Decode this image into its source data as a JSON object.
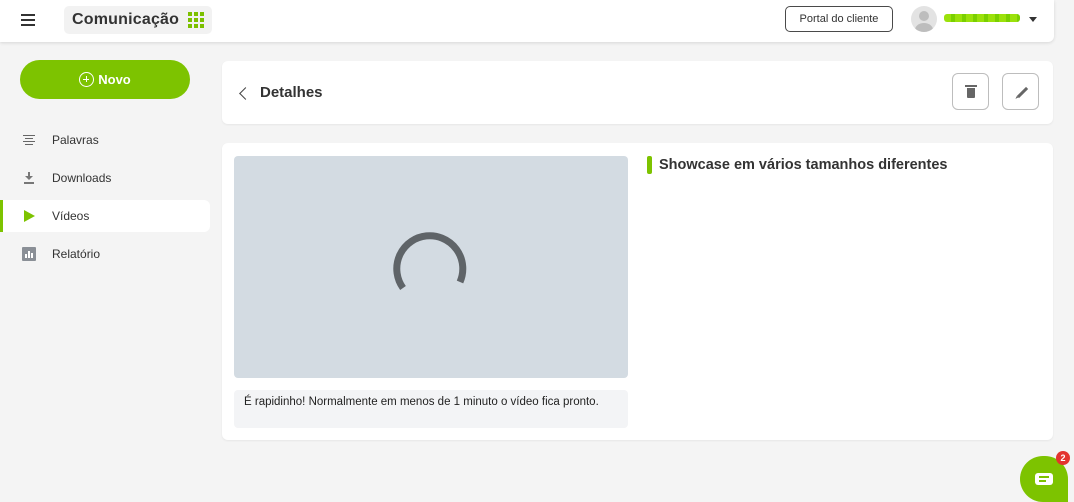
{
  "header": {
    "app_title": "Comunicação",
    "portal_label": "Portal do cliente"
  },
  "sidebar": {
    "new_label": "Novo",
    "items": [
      {
        "label": "Palavras",
        "icon": "lines-icon"
      },
      {
        "label": "Downloads",
        "icon": "download-icon"
      },
      {
        "label": "Vídeos",
        "icon": "play-icon",
        "active": true
      },
      {
        "label": "Relatório",
        "icon": "bar-chart-icon"
      }
    ]
  },
  "details": {
    "title": "Detalhes",
    "video_title": "Showcase em vários tamanhos diferentes",
    "processing_note": "É rapidinho! Normalmente em menos de 1 minuto o vídeo fica pronto."
  },
  "chat": {
    "unread": "2"
  },
  "colors": {
    "accent": "#7dc300",
    "video_placeholder": "#d3dbe2",
    "badge": "#e3342f"
  }
}
